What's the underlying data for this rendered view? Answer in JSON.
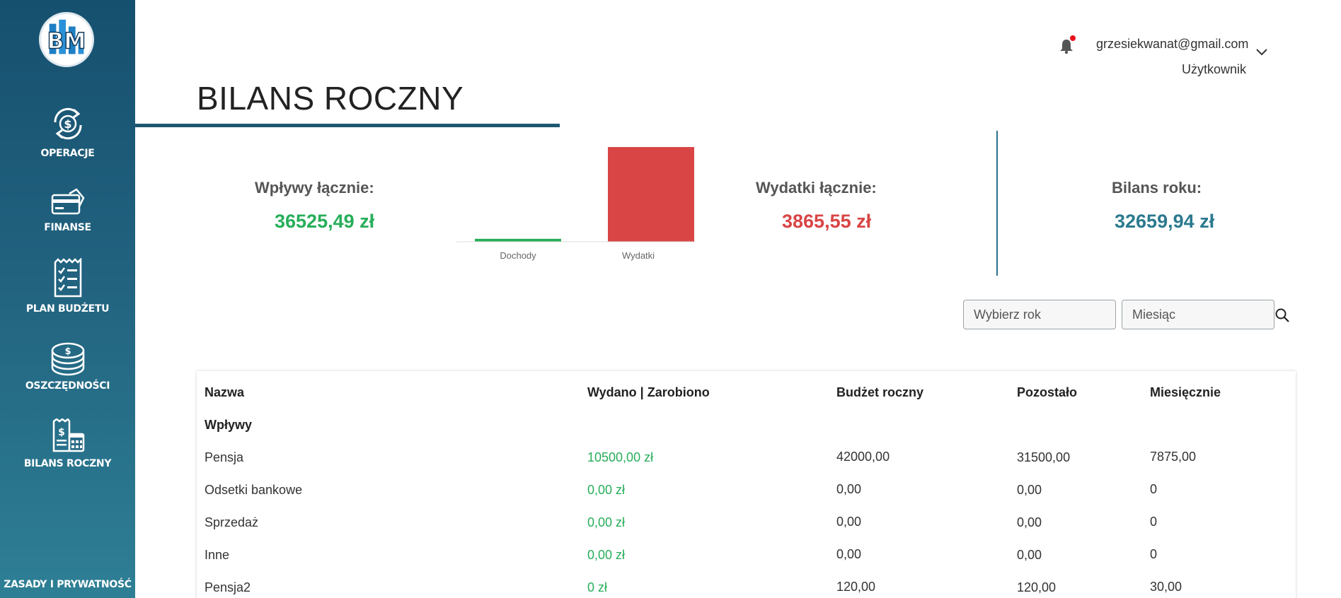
{
  "sidebar": {
    "logo_text": "BM",
    "items": [
      {
        "label": "OPERACJE",
        "icon": "dollar-cycle-icon"
      },
      {
        "label": "FINANSE",
        "icon": "credit-card-icon"
      },
      {
        "label": "PLAN BUDŻETU",
        "icon": "checklist-icon"
      },
      {
        "label": "OSZCZĘDNOŚCI",
        "icon": "coin-stack-icon"
      },
      {
        "label": "BILANS ROCZNY",
        "icon": "calendar-budget-icon"
      }
    ],
    "footer_label": "ZASADY I PRYWATNOŚĆ"
  },
  "header": {
    "email": "grzesiekwanat@gmail.com",
    "role": "Użytkownik",
    "notification_icon": "bell-icon",
    "has_notification": true
  },
  "page": {
    "title": "BILANS ROCZNY"
  },
  "summary": {
    "income_label": "Wpływy łącznie:",
    "income_value": "36525,49 zł",
    "expenses_label": "Wydatki łącznie:",
    "expenses_value": "3865,55 zł",
    "balance_label": "Bilans roku:",
    "balance_value": "32659,94 zł"
  },
  "colors": {
    "income": "#27ae5a",
    "expenses": "#d94545",
    "balance": "#2b7a8e",
    "sidebar": "#1d5870"
  },
  "chart_data": {
    "type": "bar",
    "categories": [
      "Dochody",
      "Wydatki"
    ],
    "values": [
      120,
      3865.55
    ],
    "colors": [
      "#27ae5a",
      "#d94545"
    ],
    "ylim": [
      0,
      3865.55
    ],
    "grid": false
  },
  "filters": {
    "year_placeholder": "Wybierz rok",
    "month_placeholder": "Miesiąc",
    "search_icon": "search-icon"
  },
  "table": {
    "columns": [
      "Nazwa",
      "Wydano | Zarobiono",
      "Budżet roczny",
      "Pozostało",
      "Miesięcznie"
    ],
    "section_label": "Wpływy",
    "rows": [
      {
        "name": "Pensja",
        "spent": "10500,00 zł",
        "budget": "42000,00",
        "remaining": "31500,00",
        "monthly": "7875,00"
      },
      {
        "name": "Odsetki bankowe",
        "spent": "0,00 zł",
        "budget": "0,00",
        "remaining": "0,00",
        "monthly": "0"
      },
      {
        "name": "Sprzedaż",
        "spent": "0,00 zł",
        "budget": "0,00",
        "remaining": "0,00",
        "monthly": "0"
      },
      {
        "name": "Inne",
        "spent": "0,00 zł",
        "budget": "0,00",
        "remaining": "0,00",
        "monthly": "0"
      },
      {
        "name": "Pensja2",
        "spent": "0 zł",
        "budget": "120,00",
        "remaining": "120,00",
        "monthly": "30,00"
      }
    ]
  }
}
